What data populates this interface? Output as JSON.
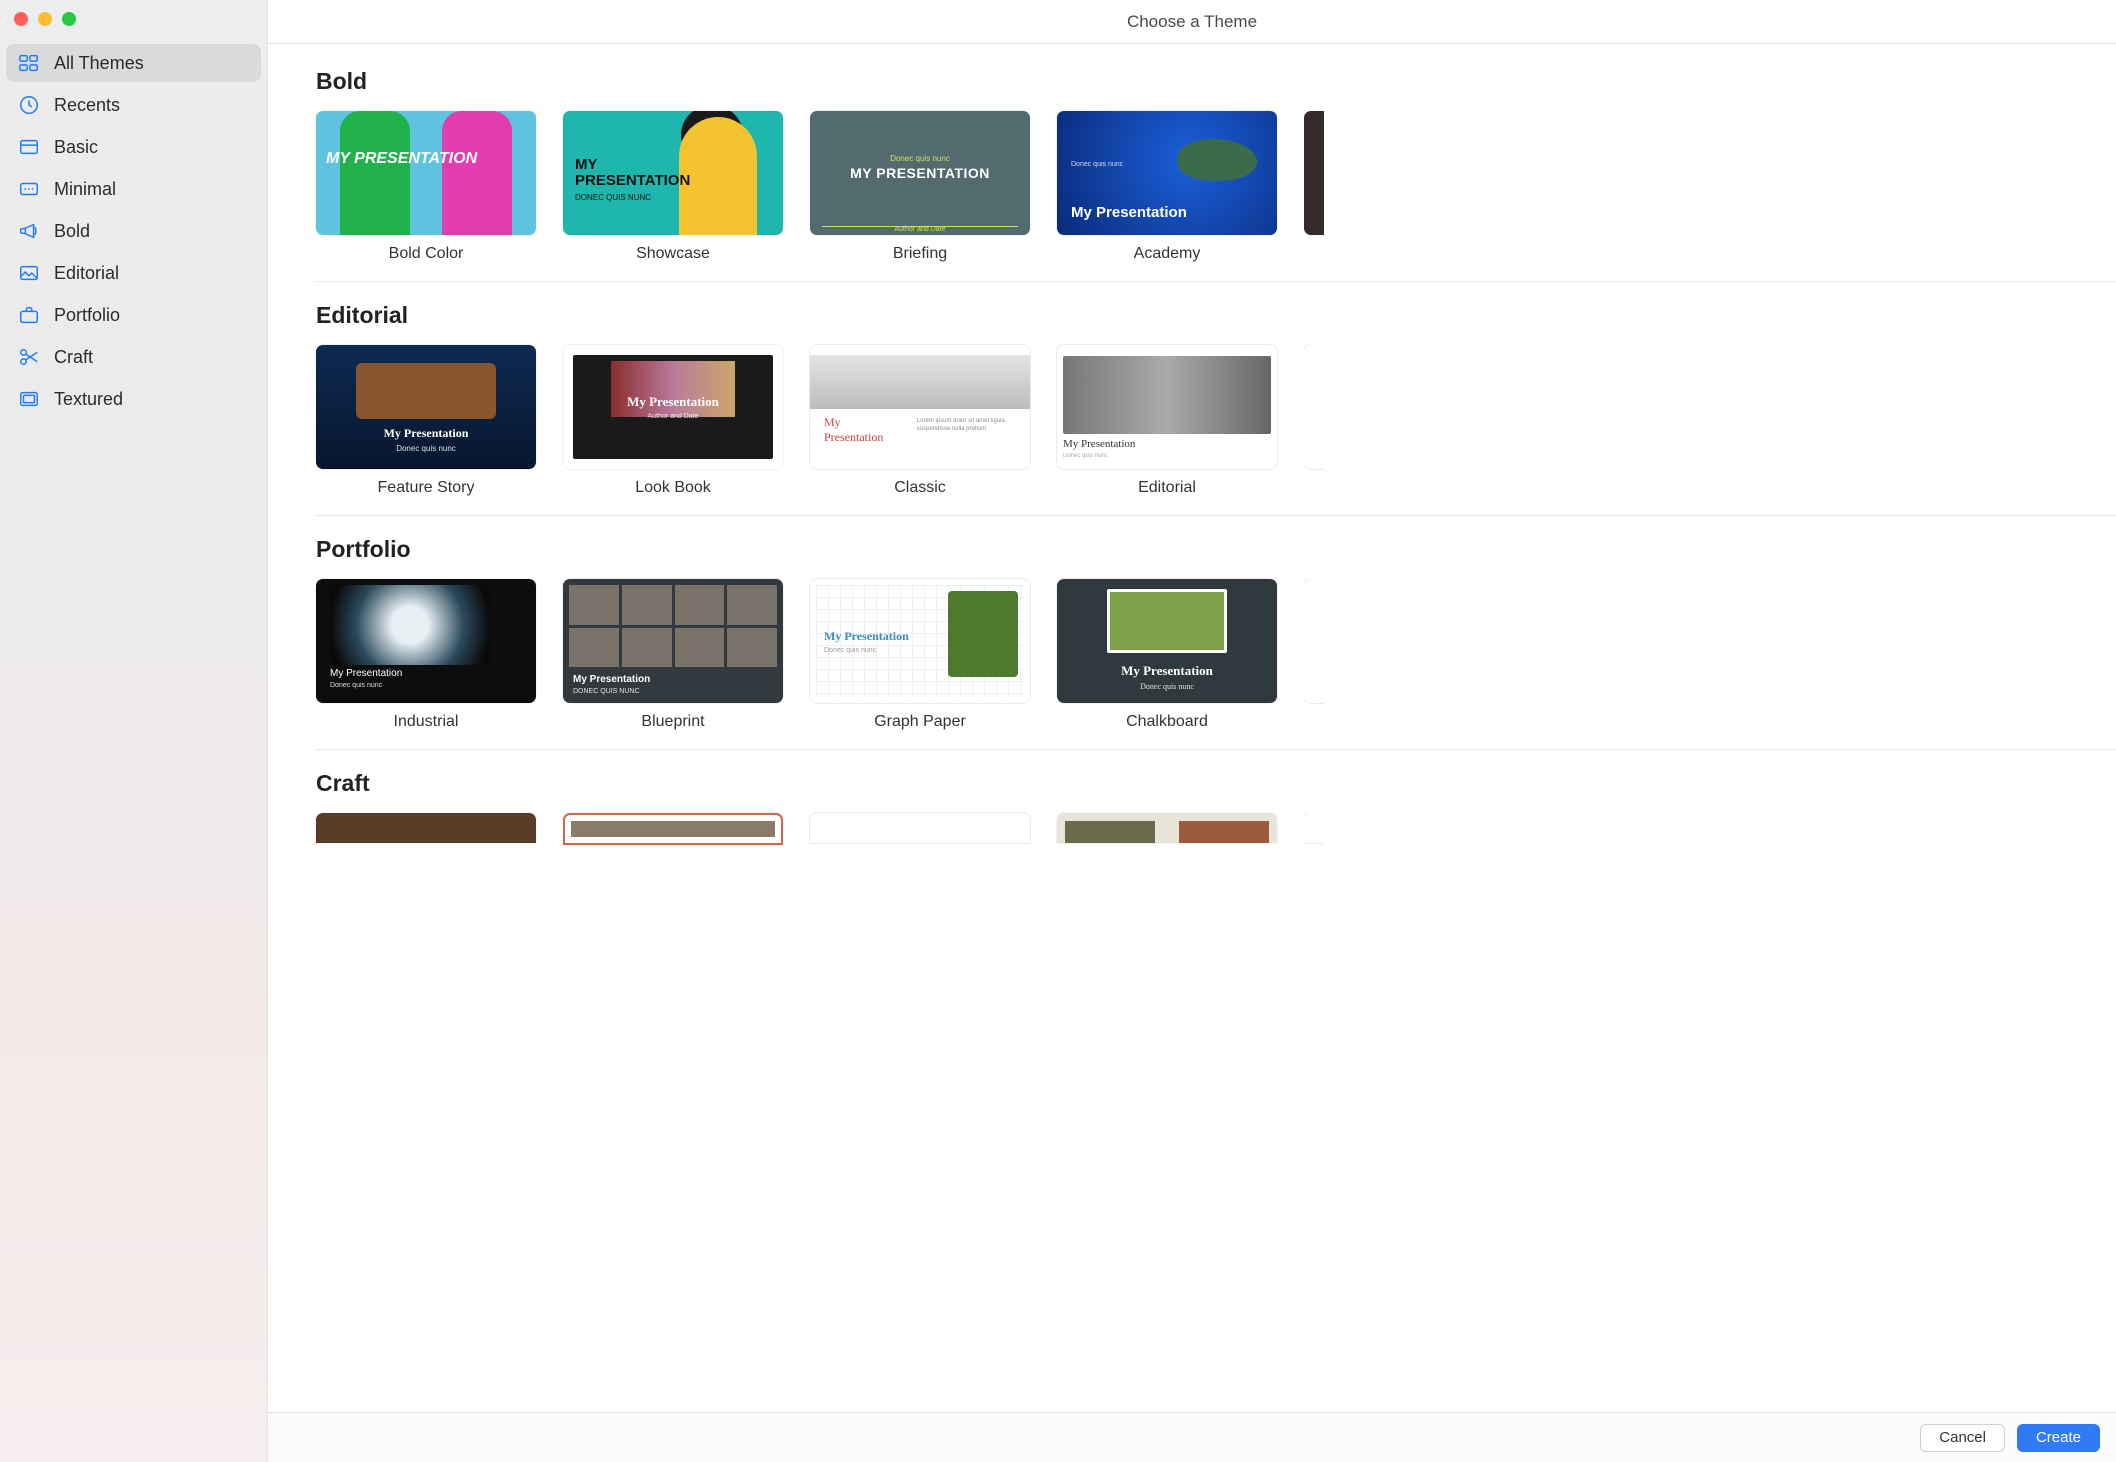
{
  "window": {
    "title": "Choose a Theme"
  },
  "sidebar": {
    "items": [
      {
        "label": "All Themes",
        "active": true
      },
      {
        "label": "Recents"
      },
      {
        "label": "Basic"
      },
      {
        "label": "Minimal"
      },
      {
        "label": "Bold"
      },
      {
        "label": "Editorial"
      },
      {
        "label": "Portfolio"
      },
      {
        "label": "Craft"
      },
      {
        "label": "Textured"
      }
    ]
  },
  "sections": {
    "bold": {
      "title": "Bold",
      "themes": [
        {
          "name": "Bold Color",
          "overlay_title": "MY PRESENTATION"
        },
        {
          "name": "Showcase",
          "overlay_title": "MY",
          "overlay_title2": "PRESENTATION",
          "overlay_sub": "DONEC QUIS NUNC"
        },
        {
          "name": "Briefing",
          "overlay_title": "MY PRESENTATION",
          "overlay_sup": "Donec quis nunc",
          "overlay_auth": "Author and Date"
        },
        {
          "name": "Academy",
          "overlay_title": "My Presentation",
          "overlay_sup": "Donec quis nunc"
        }
      ]
    },
    "editorial": {
      "title": "Editorial",
      "themes": [
        {
          "name": "Feature Story",
          "overlay_title": "My Presentation",
          "overlay_sub": "Donec quis nunc"
        },
        {
          "name": "Look Book",
          "overlay_title": "My Presentation",
          "overlay_sub": "Author and Date"
        },
        {
          "name": "Classic",
          "overlay_title": "My Presentation",
          "overlay_sub": "Lorem ipsum dolor sit amet ligula suspendisse nulla pretium"
        },
        {
          "name": "Editorial",
          "overlay_title": "My Presentation",
          "overlay_sub": "Donec quis nunc"
        }
      ]
    },
    "portfolio": {
      "title": "Portfolio",
      "themes": [
        {
          "name": "Industrial",
          "overlay_title": "My Presentation",
          "overlay_sub": "Donec quis nunc"
        },
        {
          "name": "Blueprint",
          "overlay_title": "My Presentation",
          "overlay_sub": "DONEC QUIS NUNC"
        },
        {
          "name": "Graph Paper",
          "overlay_title": "My Presentation",
          "overlay_sub": "Donec quis nunc"
        },
        {
          "name": "Chalkboard",
          "overlay_title": "My Presentation",
          "overlay_sub": "Donec quis nunc"
        }
      ]
    },
    "craft": {
      "title": "Craft"
    }
  },
  "footer": {
    "cancel": "Cancel",
    "create": "Create"
  }
}
